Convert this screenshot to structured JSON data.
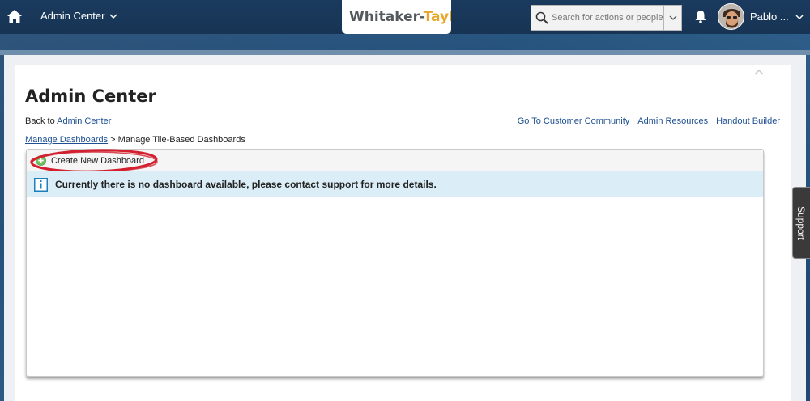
{
  "header": {
    "module_label": "Admin Center",
    "logo": {
      "text_main": "Whitaker-",
      "text_accent": "Tayl"
    },
    "search": {
      "placeholder": "Search for actions or people"
    },
    "user": {
      "name": "Pablo ..."
    }
  },
  "page": {
    "title": "Admin Center",
    "back_prefix": "Back to ",
    "back_link": "Admin Center",
    "top_links": [
      "Go To Customer Community",
      "Admin Resources",
      "Handout Builder"
    ],
    "breadcrumb": {
      "link": "Manage Dashboards",
      "separator": " > ",
      "current": "Manage Tile-Based Dashboards"
    }
  },
  "dashboard": {
    "create_label": "Create New Dashboard",
    "info_message": "Currently there is no dashboard available, please contact support for more details."
  },
  "support_tab": {
    "label": "Support"
  },
  "colors": {
    "topbar": "#173454",
    "link": "#1d4f91",
    "info_bg": "#dbeef7",
    "highlight": "#d2202f"
  }
}
